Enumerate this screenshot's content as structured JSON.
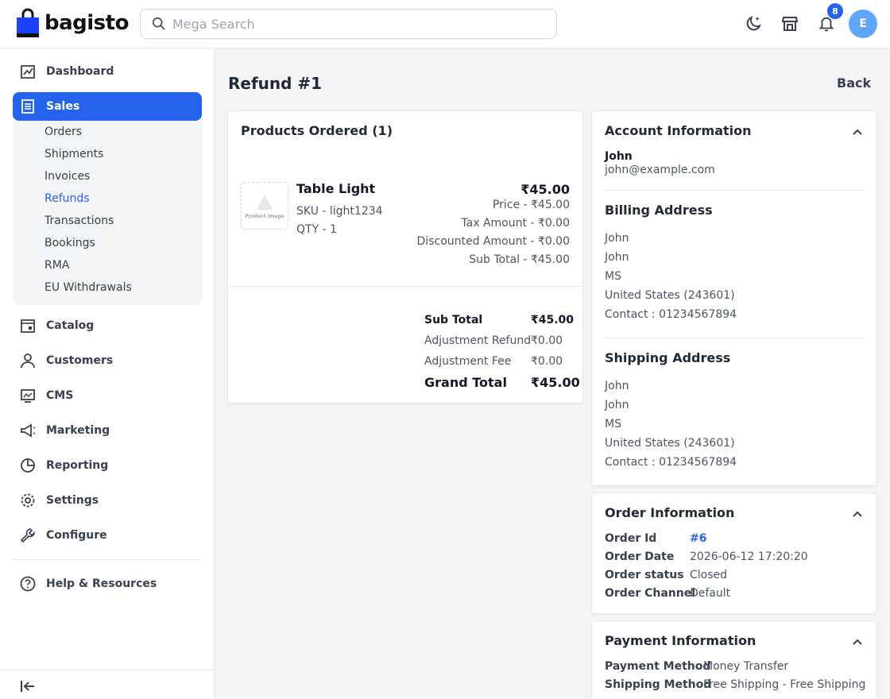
{
  "header": {
    "logo_text": "bagisto",
    "search_placeholder": "Mega Search",
    "notification_count": "8",
    "avatar_initial": "E"
  },
  "sidebar": {
    "items": [
      {
        "label": "Dashboard",
        "icon": "dashboard-icon"
      },
      {
        "label": "Sales",
        "icon": "sales-icon",
        "active": true
      },
      {
        "label": "Catalog",
        "icon": "catalog-icon"
      },
      {
        "label": "Customers",
        "icon": "customers-icon"
      },
      {
        "label": "CMS",
        "icon": "cms-icon"
      },
      {
        "label": "Marketing",
        "icon": "marketing-icon"
      },
      {
        "label": "Reporting",
        "icon": "reporting-icon"
      },
      {
        "label": "Settings",
        "icon": "settings-icon"
      },
      {
        "label": "Configure",
        "icon": "configure-icon"
      },
      {
        "label": "Help & Resources",
        "icon": "help-icon"
      }
    ],
    "sales_sub": [
      "Orders",
      "Shipments",
      "Invoices",
      "Refunds",
      "Transactions",
      "Bookings",
      "RMA",
      "EU Withdrawals"
    ],
    "active_sub": "Refunds"
  },
  "page": {
    "title": "Refund #1",
    "back_label": "Back"
  },
  "products": {
    "heading": "Products Ordered (1)",
    "image_caption": "Product Image",
    "item": {
      "name": "Table Light",
      "sku": "SKU - light1234",
      "qty": "QTY - 1",
      "price_main": "₹45.00",
      "price": "Price - ₹45.00",
      "tax": "Tax Amount - ₹0.00",
      "discount": "Discounted Amount - ₹0.00",
      "subtotal": "Sub Total - ₹45.00"
    },
    "totals": [
      {
        "label": "Sub Total",
        "value": "₹45.00"
      },
      {
        "label": "Adjustment Refund",
        "value": "₹0.00"
      },
      {
        "label": "Adjustment Fee",
        "value": "₹0.00"
      },
      {
        "label": "Grand Total",
        "value": "₹45.00"
      }
    ]
  },
  "account": {
    "heading": "Account Information",
    "name": "John",
    "email": "john@example.com",
    "billing_heading": "Billing Address",
    "billing": [
      "John",
      "John",
      "MS",
      "United States (243601)",
      "Contact : 01234567894"
    ],
    "shipping_heading": "Shipping Address",
    "shipping": [
      "John",
      "John",
      "MS",
      "United States (243601)",
      "Contact : 01234567894"
    ]
  },
  "order": {
    "heading": "Order Information",
    "rows": [
      {
        "label": "Order Id",
        "value": "#6"
      },
      {
        "label": "Order Date",
        "value": "2026-06-12 17:20:20"
      },
      {
        "label": "Order status",
        "value": "Closed"
      },
      {
        "label": "Order Channel",
        "value": "Default"
      }
    ]
  },
  "payment": {
    "heading": "Payment Information",
    "rows": [
      {
        "label": "Payment Method",
        "value": "Money Transfer"
      },
      {
        "label": "Shipping Method",
        "value": "Free Shipping - Free Shipping"
      }
    ]
  },
  "colors": {
    "accent": "#2563eb",
    "avatar": "#60a5fa"
  }
}
